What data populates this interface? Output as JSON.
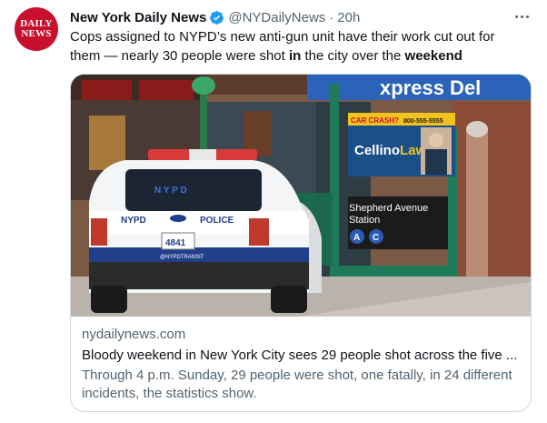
{
  "account": {
    "avatar_text_line1": "DAILY",
    "avatar_text_line2": "NEWS",
    "name": "New York Daily News",
    "handle": "@NYDailyNews",
    "separator": "·",
    "time": "20h"
  },
  "tweet": {
    "text_part1": "Cops assigned to NYPD’s new anti-gun unit have their work cut out for them — nearly 30 people were shot ",
    "text_bold1": "in",
    "text_part2": " the city over the ",
    "text_bold2": "weekend"
  },
  "card": {
    "domain": "nydailynews.com",
    "title": "Bloody weekend in New York City sees 29 people shot across the five ...",
    "description": "Through 4 p.m. Sunday, 29 people were shot, one fatally, in 24 different incidents, the statistics show.",
    "image_text": {
      "store_sign": "xpress Del",
      "ad_top": "CAR CRASH?",
      "ad_phone": "800-555-5555",
      "ad_brand1": "Cellino",
      "ad_brand2": "Law",
      "station_line1": "Shepherd Avenue",
      "station_line2": "Station",
      "train_a": "A",
      "train_c": "C",
      "car_lightbar": "N Y P D",
      "car_nypd": "NYPD",
      "car_police": "POLICE",
      "car_plate": "4841",
      "car_social": "@NYPDTRANSIT"
    }
  },
  "colors": {
    "brand_red": "#c8102e",
    "verified_blue": "#1d9bf0",
    "text_primary": "#0f1419",
    "text_secondary": "#536471",
    "subway_green": "#1f7a5a"
  }
}
